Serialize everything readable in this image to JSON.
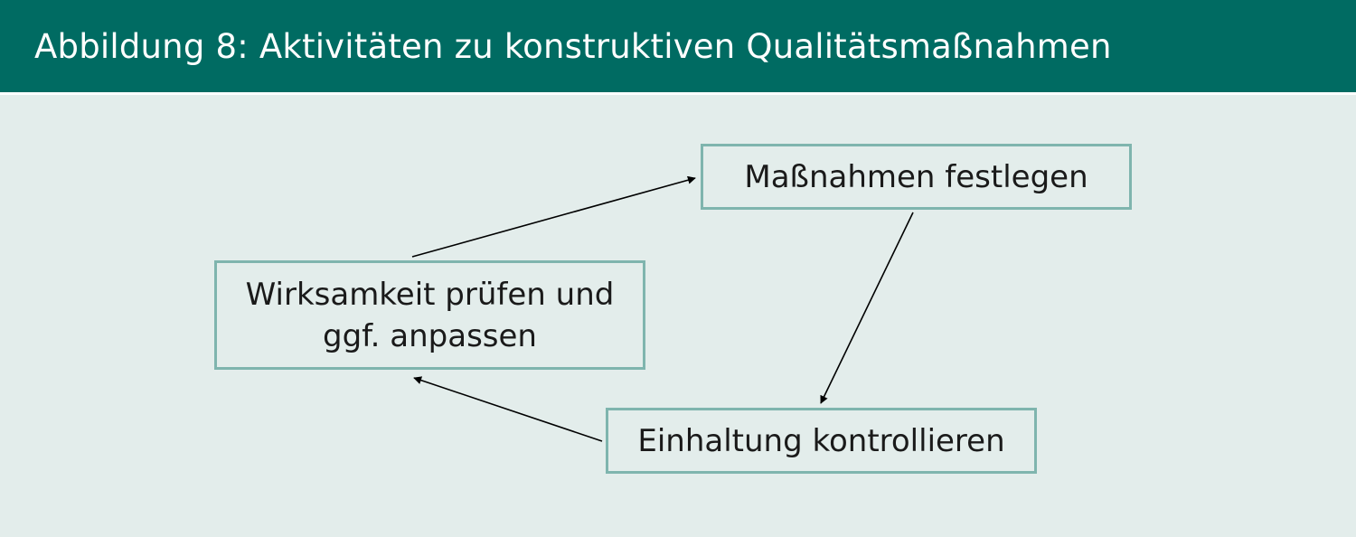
{
  "header": {
    "title": "Abbildung 8: Aktivitäten zu konstruktiven Qualitätsmaßnahmen"
  },
  "diagram": {
    "nodes": {
      "measures": "Maßnahmen festlegen",
      "effectiveness": "Wirksamkeit prüfen und\nggf. anpassen",
      "control": "Einhaltung kontrollieren"
    }
  },
  "colors": {
    "header_bg": "#006b62",
    "canvas_bg": "#e3edeb",
    "box_border": "#7fb5ae",
    "arrow": "#000000"
  }
}
